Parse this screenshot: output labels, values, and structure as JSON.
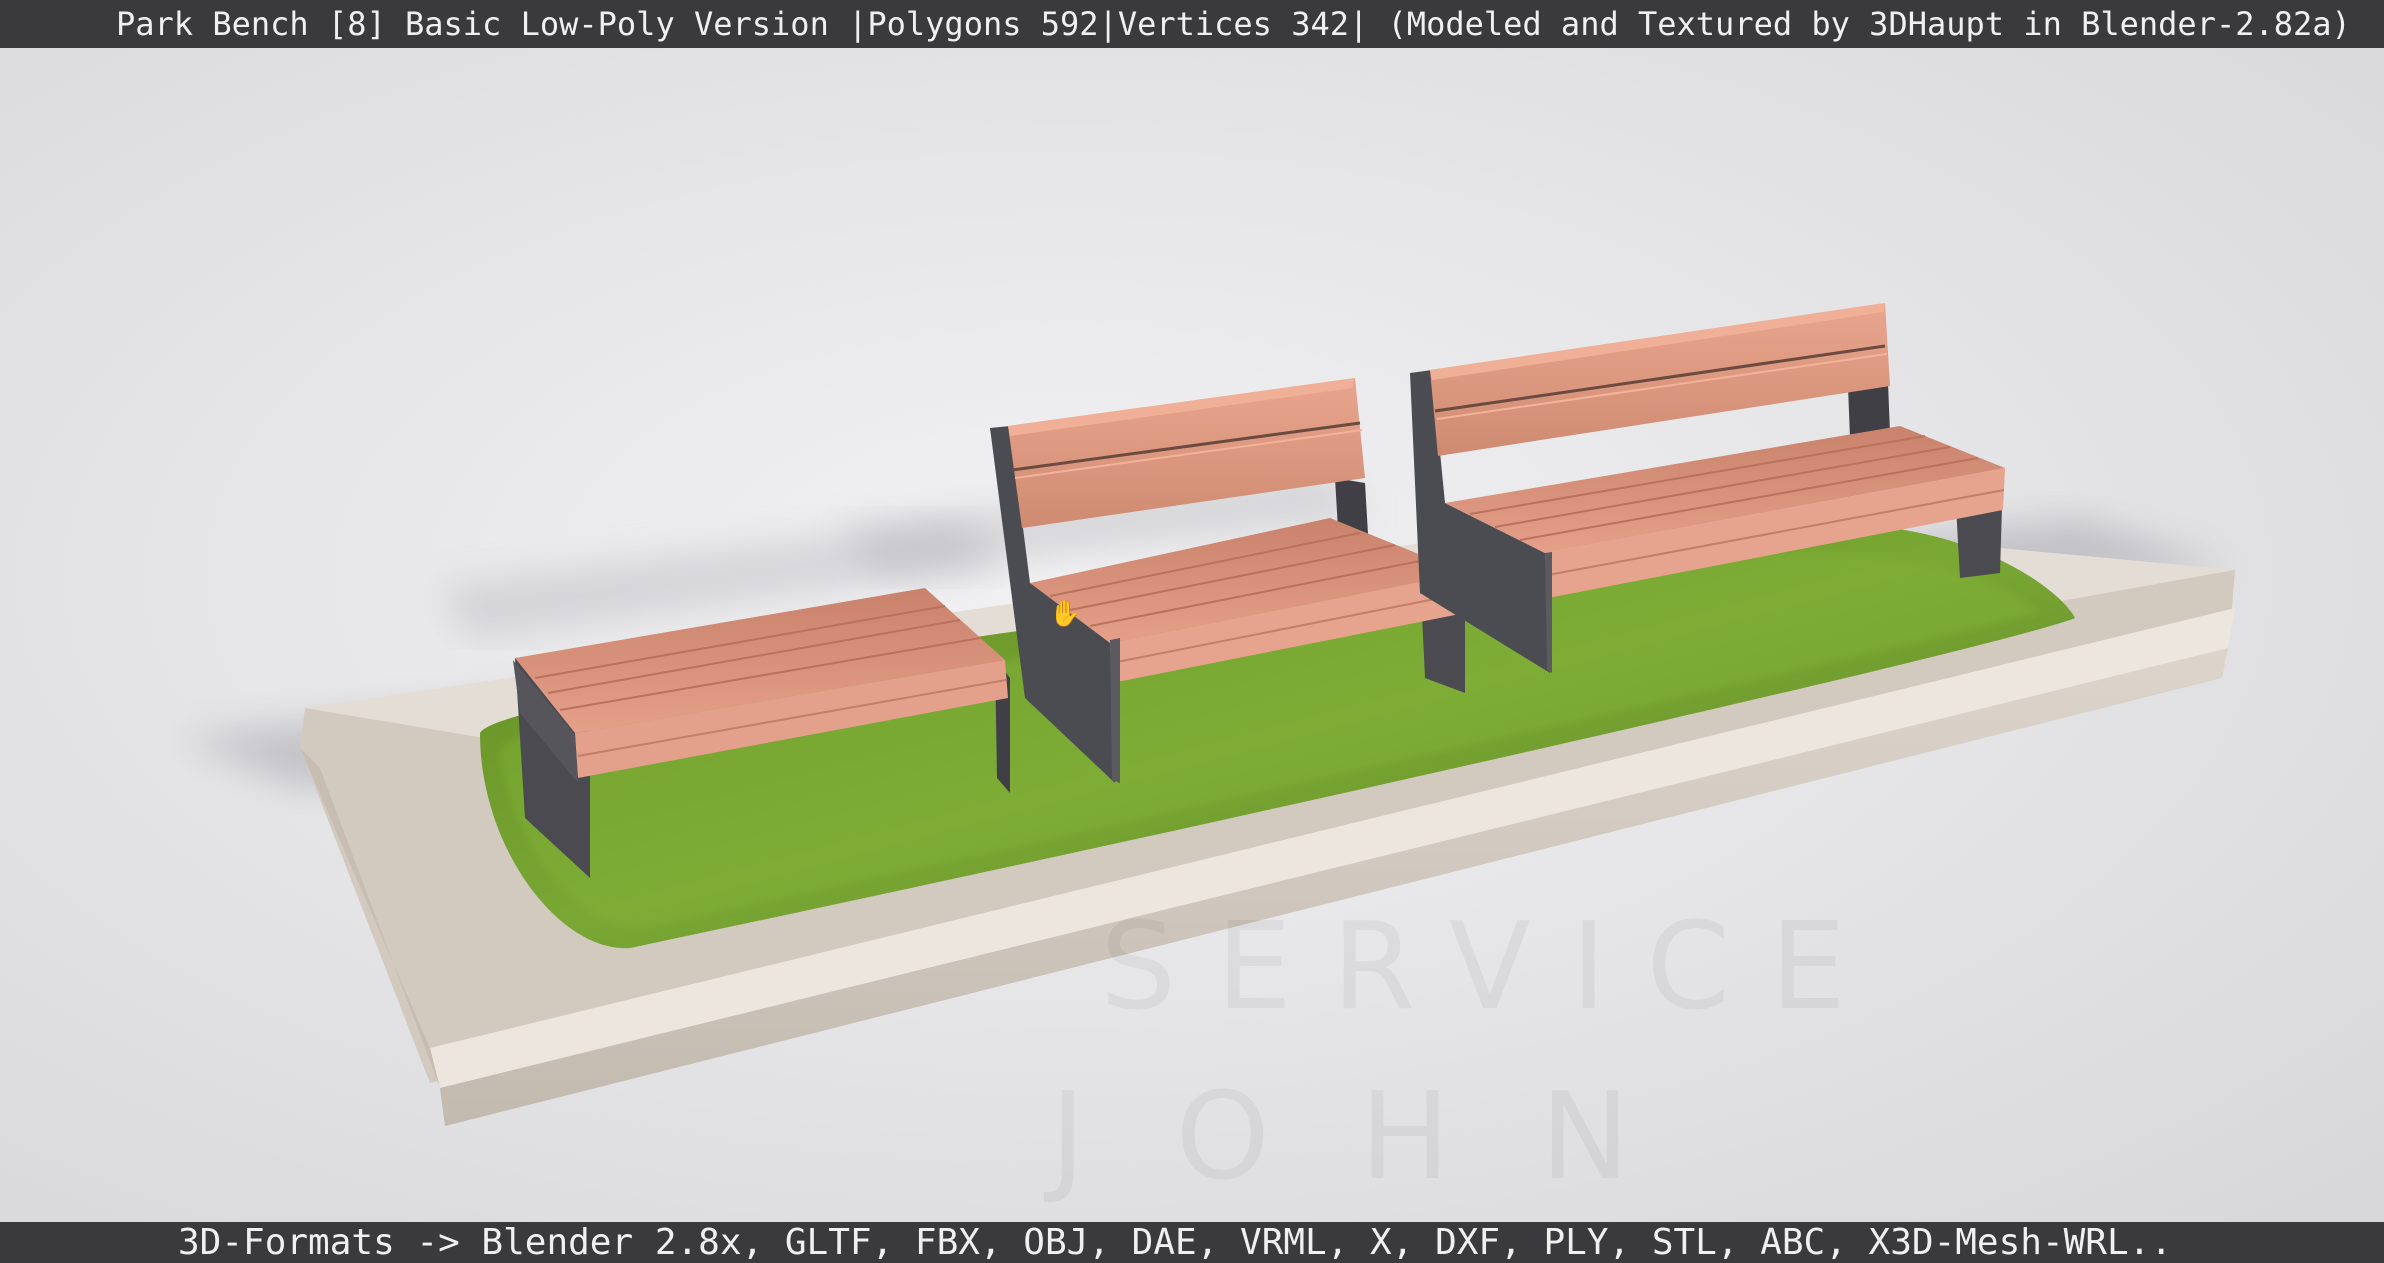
{
  "header": {
    "title": "Park Bench [8] Basic Low-Poly Version |Polygons 592|Vertices 342| (Modeled and Textured by 3DHaupt in Blender-2.82a)"
  },
  "footer": {
    "formats": "3D-Formats -> Blender 2.8x, GLTF, FBX, OBJ, DAE, VRML, X, DXF, PLY, STL, ABC, X3D-Mesh-WRL.."
  },
  "scene": {
    "description_objects": [
      "stone-planter-base",
      "grass-patch",
      "bench-stool",
      "bench-single-seat",
      "bench-double-seat"
    ],
    "watermark_lines": [
      "SERVICE",
      "JOHN"
    ]
  },
  "colors": {
    "bar_bg": "#3a3a3c",
    "bar_text": "#f0f0f0",
    "background": "#e6e6e8",
    "wood": "#d48d75",
    "metal": "#4a4a50",
    "grass": "#6f9a2c",
    "stone": "#cdc4bb"
  },
  "icons": {
    "cursor": "grab-hand-icon"
  }
}
